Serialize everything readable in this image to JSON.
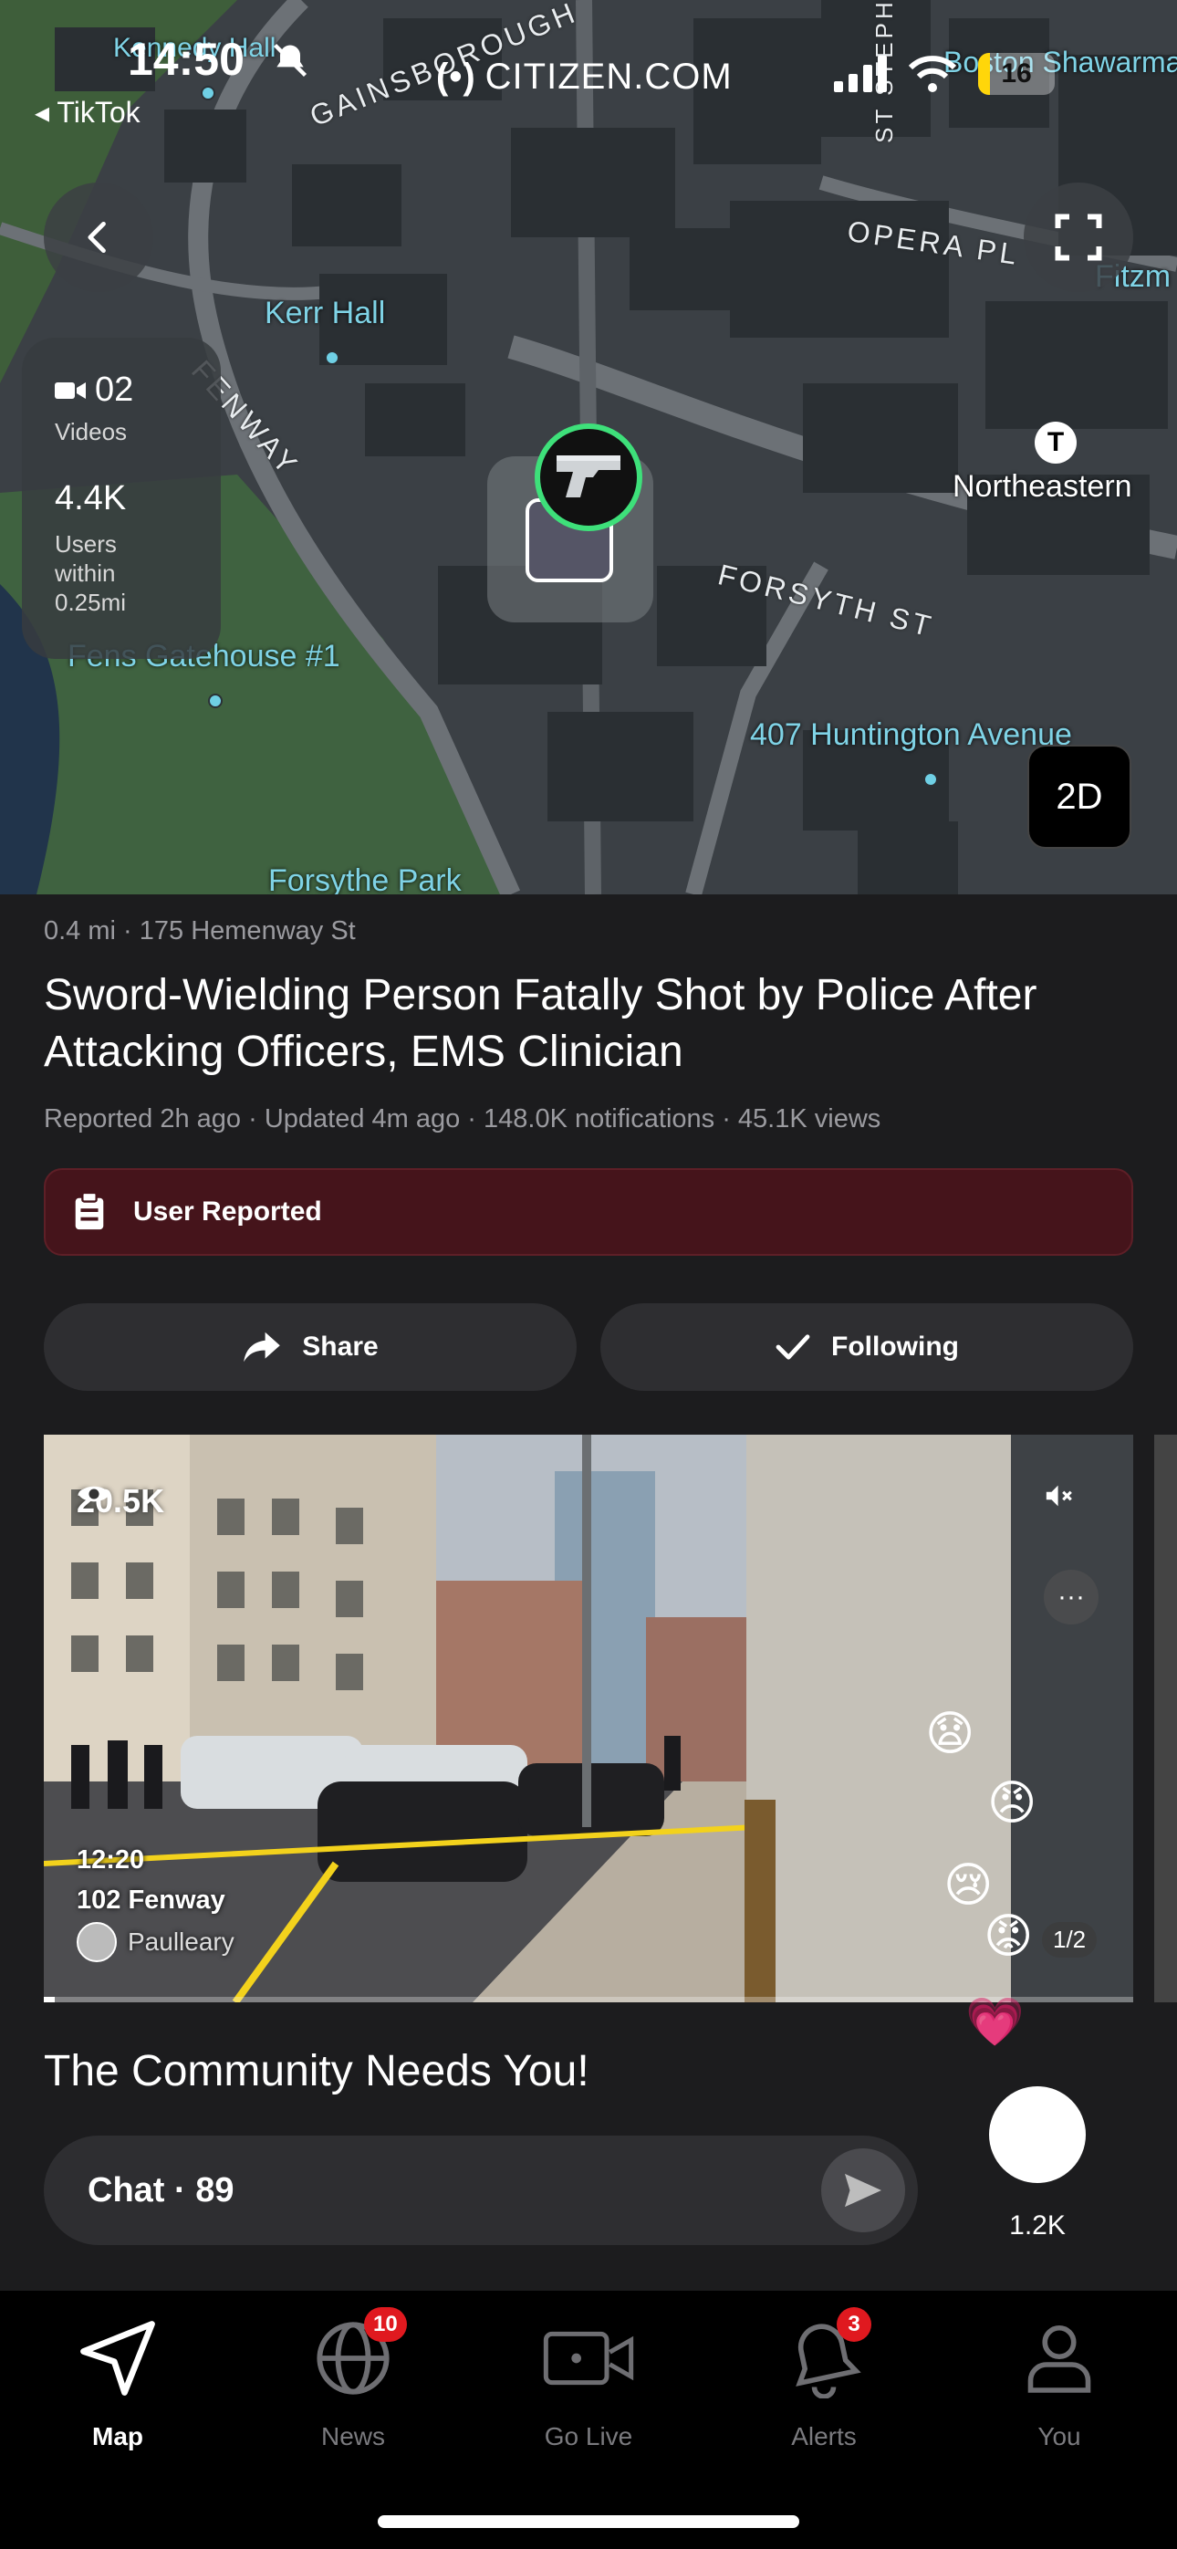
{
  "status": {
    "time": "14:50",
    "back_app": "TikTok",
    "battery": "16",
    "battery_level": 0.16
  },
  "brand": {
    "logo": "(•)",
    "name": "CITIZEN.COM"
  },
  "map": {
    "labels": {
      "kennedy_hall": "Kennedy Hall",
      "boston_shawarma": "Boston Shawarma",
      "kerr_hall": "Kerr Hall",
      "northeastern": "Northeastern",
      "gatehouse": "Fens Gatehouse #1",
      "huntington": "407 Huntington Avenue",
      "forsythe_park": "Forsythe Park",
      "gainsborough": "GAINSBOROUGH",
      "opera_pl": "OPERA PL",
      "fenway": "FENWAY",
      "forsyth_st": "FORSYTH ST",
      "st_stephen": "ST STEPHEN",
      "fitzm": "Fitzm",
      "t_stop": "T"
    },
    "stats": {
      "videos_count": "02",
      "videos_label": "Videos",
      "users_count": "4.4K",
      "users_label_1": "Users",
      "users_label_2": "within",
      "users_label_3": "0.25mi"
    },
    "mode_button": "2D",
    "icons": {
      "back": "chevron-left-icon",
      "expand": "expand-icon",
      "incident": "gun-icon"
    }
  },
  "incident": {
    "distance": "0.4 mi",
    "address": "175 Hemenway St",
    "title": "Sword-Wielding Person Fatally Shot by Police After Attacking Officers, EMS Clinician",
    "reported": "Reported 2h ago · Updated 4m ago · 148.0K notifications · 45.1K views",
    "source_badge": "User Reported",
    "share_label": "Share",
    "following_label": "Following"
  },
  "video": {
    "views": "20.5K",
    "time": "12:20",
    "place": "102 Fenway",
    "user": "Paulleary",
    "counter": "1/2",
    "progress": 0.01
  },
  "community": {
    "heading": "The Community Needs You!",
    "chat_label": "Chat · 89",
    "reaction_count": "1.2K"
  },
  "tabs": [
    {
      "label": "Map",
      "icon": "navigation-arrow-icon",
      "badge": ""
    },
    {
      "label": "News",
      "icon": "globe-icon",
      "badge": "10"
    },
    {
      "label": "Go Live",
      "icon": "video-camera-icon",
      "badge": ""
    },
    {
      "label": "Alerts",
      "icon": "bell-icon",
      "badge": "3"
    },
    {
      "label": "You",
      "icon": "person-icon",
      "badge": ""
    }
  ],
  "colors": {
    "following_green": "#3ee07a",
    "user_reported_bg": "#45141b",
    "badge_red": "#e0191f",
    "map_label": "#7fd3e6"
  }
}
